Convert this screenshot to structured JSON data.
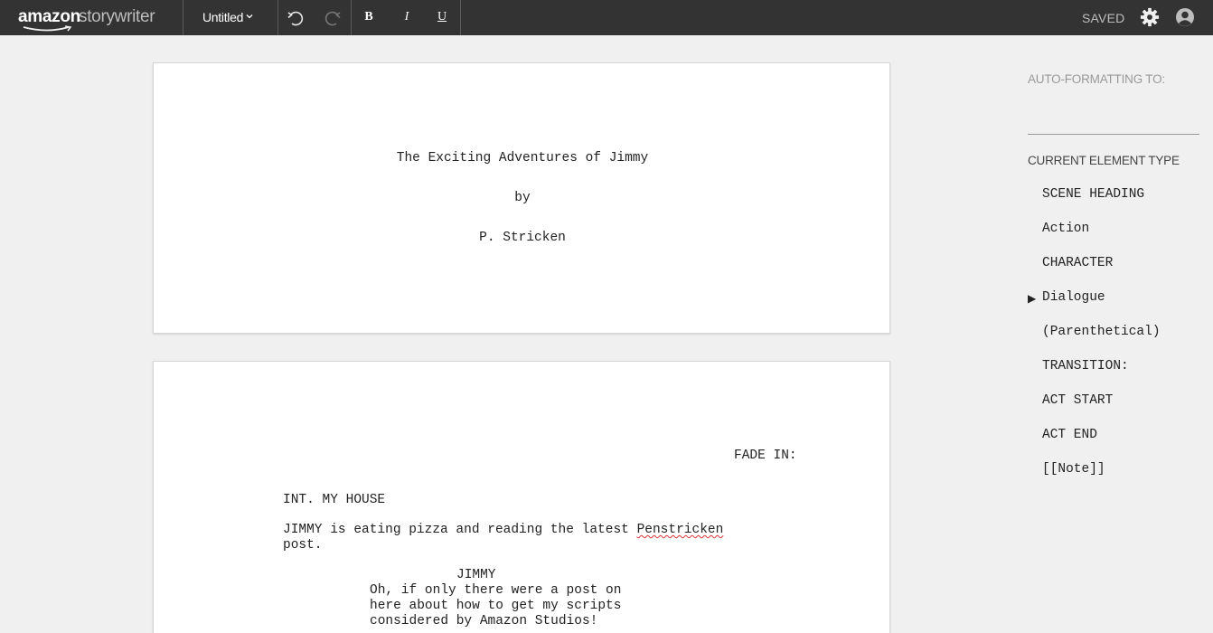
{
  "app": {
    "logo_amazon": "amazon",
    "logo_story": "storywriter",
    "document_title": "Untitled",
    "save_status": "SAVED"
  },
  "toolbar": {
    "bold": "B",
    "italic": "I",
    "underline": "U"
  },
  "icons": {
    "undo": "undo-icon",
    "redo": "redo-icon",
    "settings": "gear-icon",
    "user": "user-icon",
    "dropdown": "chevron-down-icon"
  },
  "title_page": {
    "title": "The Exciting Adventures of Jimmy",
    "by": "by",
    "author": "P. Stricken"
  },
  "script": {
    "transition": "FADE IN:",
    "scene_heading": "INT. MY HOUSE",
    "action_line1_pre": "JIMMY is eating pizza and reading the latest ",
    "action_line1_misspelled": "Penstricken",
    "action_line2": "post.",
    "character": "JIMMY",
    "dialogue_lines": [
      "Oh, if only there were a post on",
      "here about how to get my scripts",
      "considered by Amazon Studios!"
    ]
  },
  "panel": {
    "auto_formatting_label": "AUTO-FORMATTING TO:",
    "current_type_label": "CURRENT ELEMENT TYPE",
    "selected_marker": "▶",
    "element_types": [
      "SCENE HEADING",
      "Action",
      "CHARACTER",
      "Dialogue",
      "(Parenthetical)",
      "TRANSITION:",
      "ACT START",
      "ACT END",
      "[[Note]]"
    ],
    "selected_index": 3
  },
  "colors": {
    "topbar": "#333333",
    "background": "#f0f0f0",
    "page": "#ffffff",
    "muted_text": "#999999"
  }
}
